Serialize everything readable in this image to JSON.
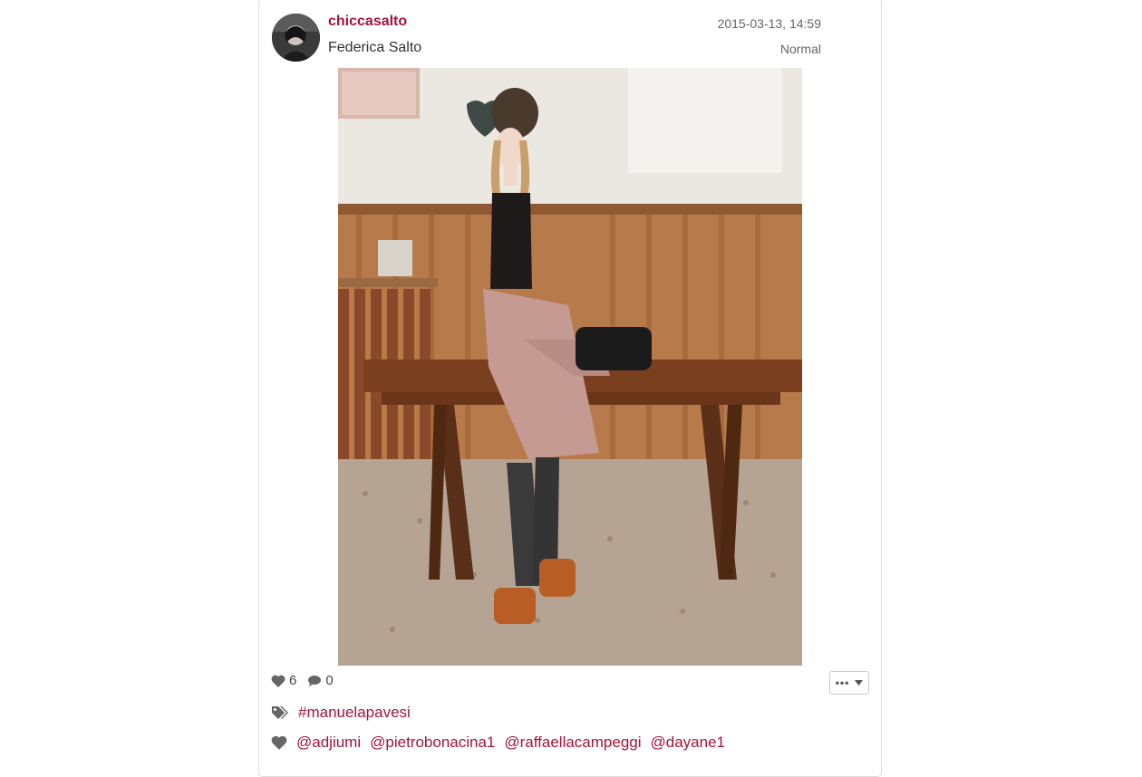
{
  "post": {
    "username": "chiccasalto",
    "full_name": "Federica Salto",
    "timestamp": "2015-03-13, 14:59",
    "filter": "Normal",
    "likes": "6",
    "comments": "0",
    "tags": [
      "#manuelapavesi"
    ],
    "tagged_users": [
      "@adjiumi",
      "@pietrobonacina1",
      "@raffaellacampeggi",
      "@dayane1"
    ]
  },
  "colors": {
    "accent": "#a3143c",
    "icon": "#666666"
  },
  "icons": {
    "likes": "heart-icon",
    "comments": "comment-icon",
    "tags": "tags-icon",
    "tagged_users": "heart-icon",
    "more": "ellipsis-icon",
    "dropdown": "caret-down-icon"
  }
}
